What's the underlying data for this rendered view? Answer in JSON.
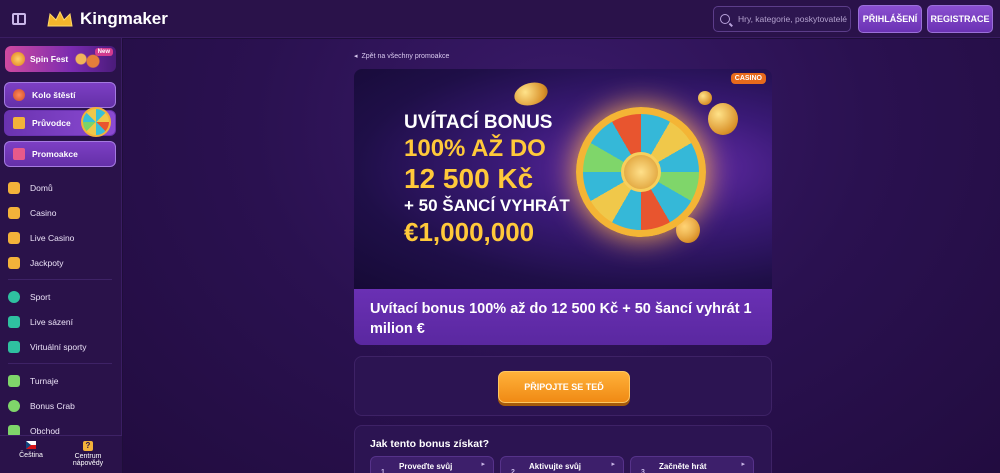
{
  "header": {
    "brand": "Kingmaker",
    "search_placeholder": "Hry, kategorie, poskytovatelé",
    "login_label": "PŘIHLÁŠENÍ",
    "register_label": "REGISTRACE"
  },
  "sidebar": {
    "spin_fest": {
      "label": "Spin Fest",
      "badge": "New"
    },
    "wheel_label": "Kolo štěstí",
    "guide_label": "Průvodce",
    "promo_label": "Promoakce",
    "items": [
      {
        "label": "Domů",
        "icon": "home-icon",
        "color": "#f3b23a"
      },
      {
        "label": "Casino",
        "icon": "casino-icon",
        "color": "#f3b23a"
      },
      {
        "label": "Live Casino",
        "icon": "live-casino-icon",
        "color": "#f3b23a"
      },
      {
        "label": "Jackpoty",
        "icon": "jackpot-icon",
        "color": "#f3b23a"
      },
      {
        "label": "Sport",
        "icon": "sport-icon",
        "color": "#2fc0a0"
      },
      {
        "label": "Live sázení",
        "icon": "live-betting-icon",
        "color": "#2fc0a0"
      },
      {
        "label": "Virtuální sporty",
        "icon": "virtual-sports-icon",
        "color": "#2fc0a0"
      },
      {
        "label": "Turnaje",
        "icon": "trophy-icon",
        "color": "#7fd66a"
      },
      {
        "label": "Bonus Crab",
        "icon": "bonus-crab-icon",
        "color": "#7fd66a"
      },
      {
        "label": "Obchod",
        "icon": "shop-icon",
        "color": "#7fd66a"
      }
    ],
    "footer": {
      "language": "Čeština",
      "help_line1": "Centrum",
      "help_line2": "nápovědy"
    }
  },
  "main": {
    "back_link": "Zpět na všechny promoakce",
    "hero": {
      "badge": "CASINO",
      "line1": "UVÍTACÍ BONUS",
      "line2": "100% AŽ DO",
      "line3": "12 500 Kč",
      "line4": "+ 50 ŠANCÍ VYHRÁT",
      "line5": "€1,000,000"
    },
    "promo_title": "Uvítací bonus 100% až do 12 500 Kč + 50 šancí vyhrát 1 milion €",
    "join_label": "PŘIPOJTE SE TEĎ",
    "how_title": "Jak tento bonus získat?",
    "steps": [
      {
        "num": "1",
        "label": "Proveďte svůj"
      },
      {
        "num": "2",
        "label": "Aktivujte svůj"
      },
      {
        "num": "3",
        "label": "Začněte hrát"
      }
    ]
  },
  "colors": {
    "accent": "#ffc93a",
    "purple": "#6a30b4",
    "orange": "#f08a14"
  }
}
